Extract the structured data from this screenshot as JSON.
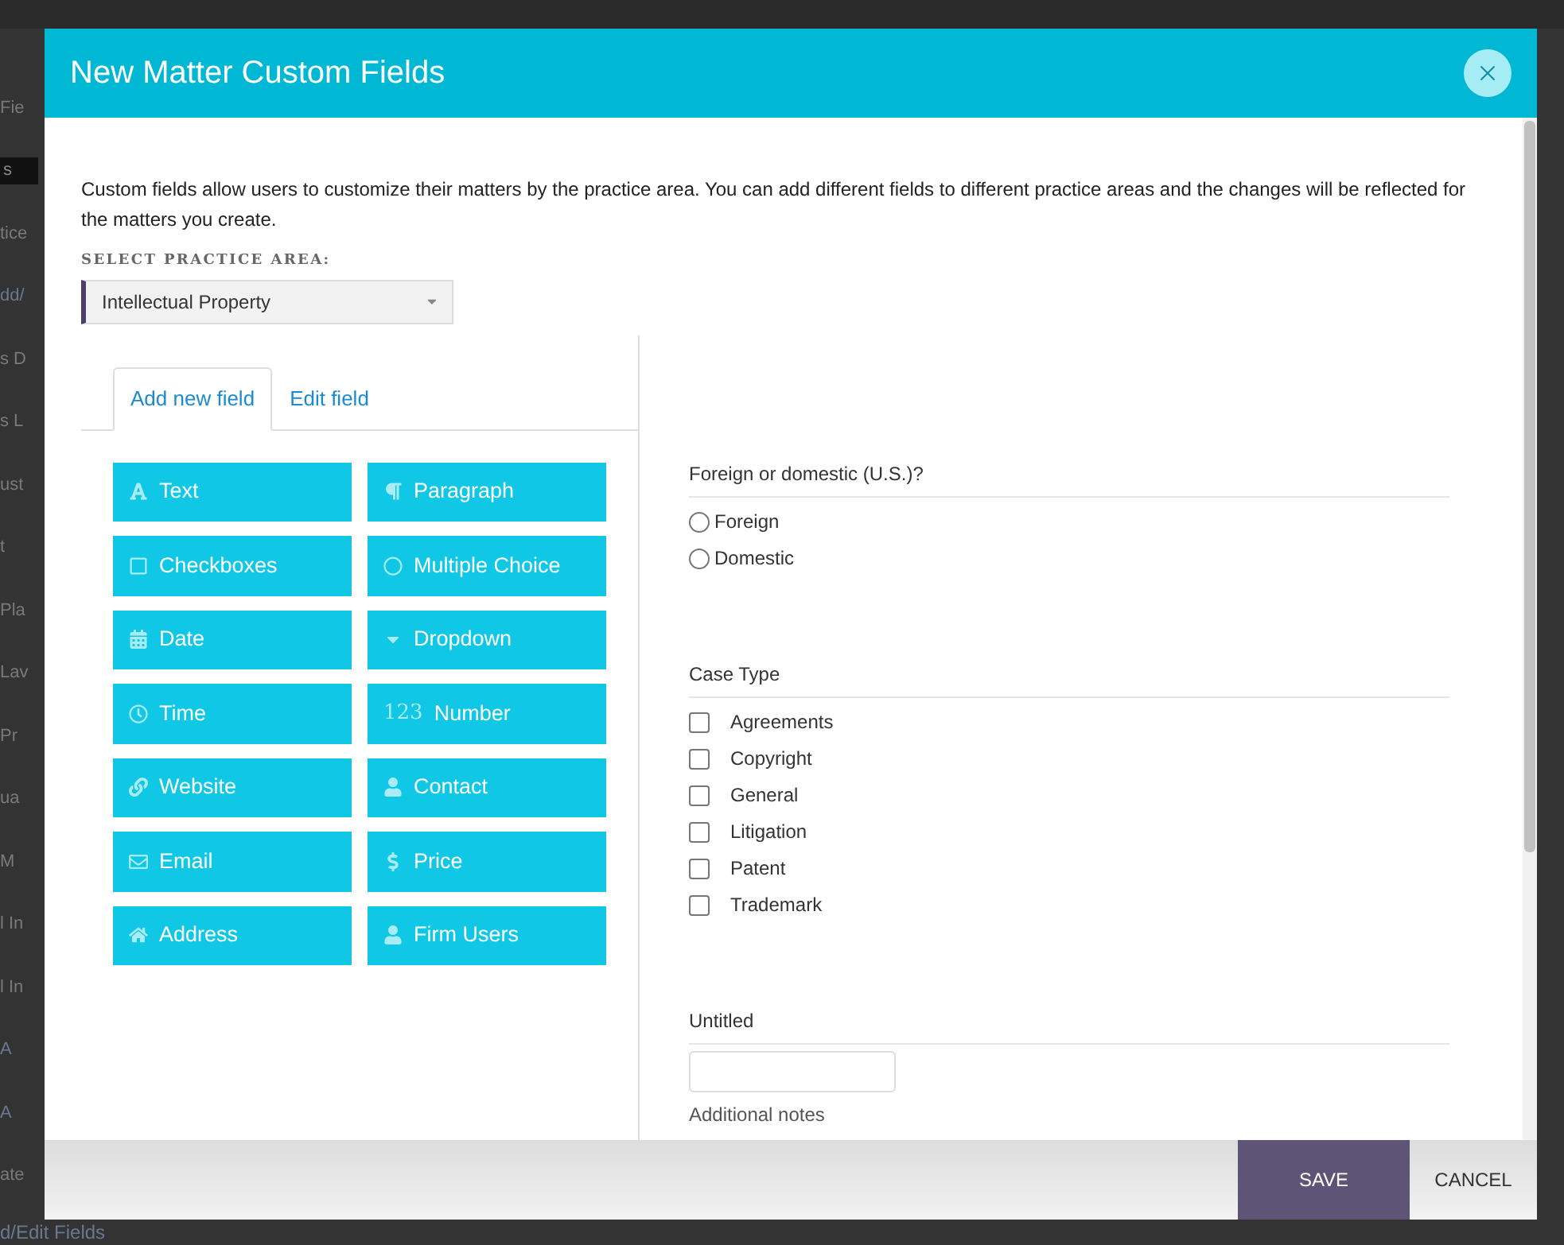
{
  "background_page": {
    "fragments": [
      {
        "text": "Fie",
        "kind": "plain"
      },
      {
        "text": "s",
        "kind": "bar"
      },
      {
        "text": "tice",
        "kind": "plain"
      },
      {
        "text": "dd/",
        "kind": "link"
      },
      {
        "text": "s D",
        "kind": "plain"
      },
      {
        "text": "s L",
        "kind": "plain"
      },
      {
        "text": "ust",
        "kind": "plain"
      },
      {
        "text": "t",
        "kind": "plain"
      },
      {
        "text": "Pla",
        "kind": "plain"
      },
      {
        "text": "Lav",
        "kind": "plain"
      },
      {
        "text": "Pr",
        "kind": "plain"
      },
      {
        "text": "ua",
        "kind": "plain"
      },
      {
        "text": "M",
        "kind": "plain"
      },
      {
        "text": "l In",
        "kind": "plain"
      },
      {
        "text": "l In",
        "kind": "plain"
      },
      {
        "text": "A",
        "kind": "link"
      },
      {
        "text": "A",
        "kind": "link"
      },
      {
        "text": "ate",
        "kind": "plain"
      }
    ],
    "footer_link": "d/Edit Fields"
  },
  "window": {
    "title": "New Matter Custom Fields"
  },
  "intro": "Custom fields allow users to customize their matters by the practice area. You can add different fields to different practice areas and the changes will be reflected for the matters you create.",
  "practice_area": {
    "label": "SELECT PRACTICE AREA:",
    "value": "Intellectual Property"
  },
  "tabs": [
    {
      "label": "Add new field",
      "selected": true
    },
    {
      "label": "Edit field",
      "selected": false
    }
  ],
  "field_types": [
    {
      "label": "Text",
      "kind": "text"
    },
    {
      "label": "Paragraph",
      "kind": "paragraph"
    },
    {
      "label": "Checkboxes",
      "kind": "checkboxes"
    },
    {
      "label": "Multiple Choice",
      "kind": "choice"
    },
    {
      "label": "Date",
      "kind": "date"
    },
    {
      "label": "Dropdown",
      "kind": "dropdown"
    },
    {
      "label": "Time",
      "kind": "time"
    },
    {
      "label": "Number",
      "kind": "number",
      "glyph": "123"
    },
    {
      "label": "Website",
      "kind": "website"
    },
    {
      "label": "Contact",
      "kind": "contact"
    },
    {
      "label": "Email",
      "kind": "email"
    },
    {
      "label": "Price",
      "kind": "price"
    },
    {
      "label": "Address",
      "kind": "address"
    },
    {
      "label": "Firm Users",
      "kind": "contact"
    }
  ],
  "preview_fields": [
    {
      "kind": "radio",
      "label": "Foreign or domestic (U.S.)?",
      "options": [
        {
          "label": "Foreign",
          "selected": false
        },
        {
          "label": "Domestic",
          "selected": false
        }
      ]
    },
    {
      "kind": "checkbox",
      "label": "Case Type",
      "options": [
        {
          "label": "Agreements",
          "checked": false
        },
        {
          "label": "Copyright",
          "checked": false
        },
        {
          "label": "General",
          "checked": false
        },
        {
          "label": "Litigation",
          "checked": false
        },
        {
          "label": "Patent",
          "checked": false
        },
        {
          "label": "Trademark",
          "checked": false
        }
      ]
    },
    {
      "kind": "text",
      "label": "Untitled",
      "help": "Additional notes"
    }
  ],
  "footer_buttons": [
    {
      "label": "SAVE",
      "kind": "primary"
    },
    {
      "label": "CANCEL",
      "kind": "secondary"
    }
  ]
}
